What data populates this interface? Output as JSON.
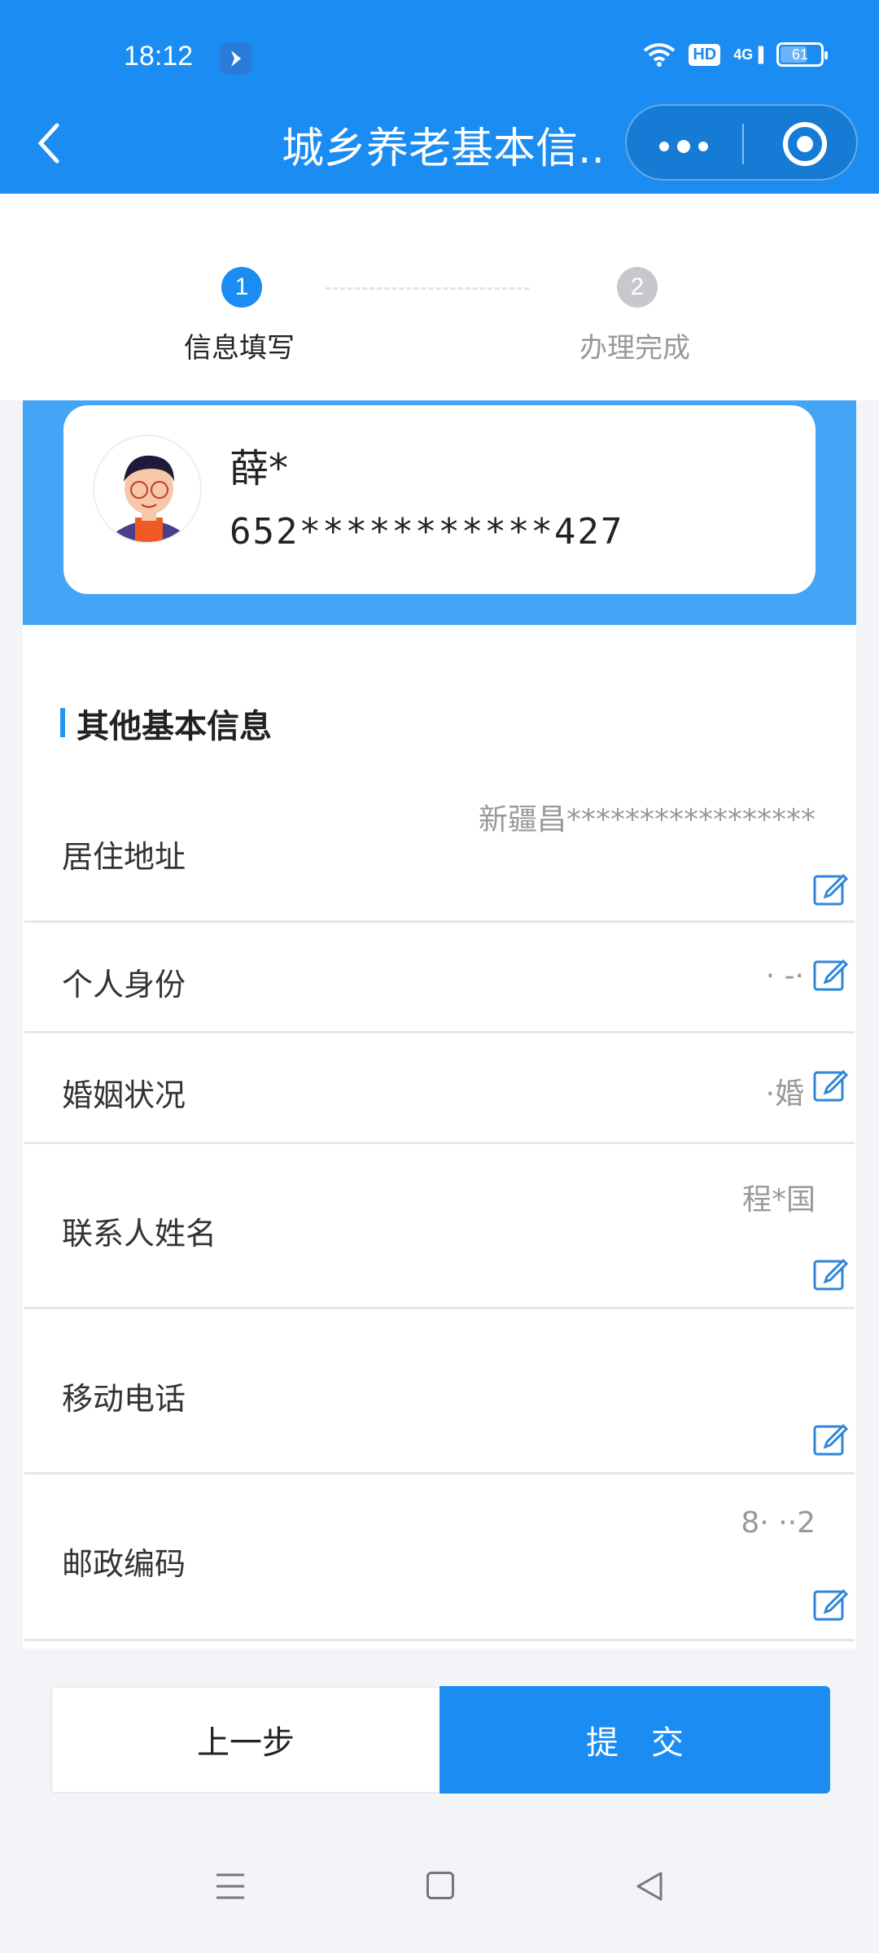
{
  "status_bar": {
    "time": "18:12",
    "hd": "HD",
    "signal": "4G",
    "battery": "61",
    "battery_level": 0.61
  },
  "nav": {
    "title": "城乡养老基本信...",
    "more_icon": "more-dots-icon",
    "close_icon": "target-icon"
  },
  "steps": [
    {
      "num": "1",
      "label": "信息填写"
    },
    {
      "num": "2",
      "label": "办理完成"
    }
  ],
  "profile": {
    "name": "薛*",
    "id": "652***********427"
  },
  "section": {
    "title": "其他基本信息"
  },
  "fields": [
    {
      "label": "居住地址",
      "value": "新疆昌*****************"
    },
    {
      "label": "个人身份",
      "value": "· -·"
    },
    {
      "label": "婚姻状况",
      "value": "·婚"
    },
    {
      "label": "联系人姓名",
      "value": "程*国"
    },
    {
      "label": "移动电话",
      "value": ""
    },
    {
      "label": "邮政编码",
      "value": "8·  ··2"
    }
  ],
  "buttons": {
    "prev": "上一步",
    "submit": "提交"
  },
  "colors": {
    "primary": "#1a8cf2",
    "band": "#42a5f5"
  }
}
